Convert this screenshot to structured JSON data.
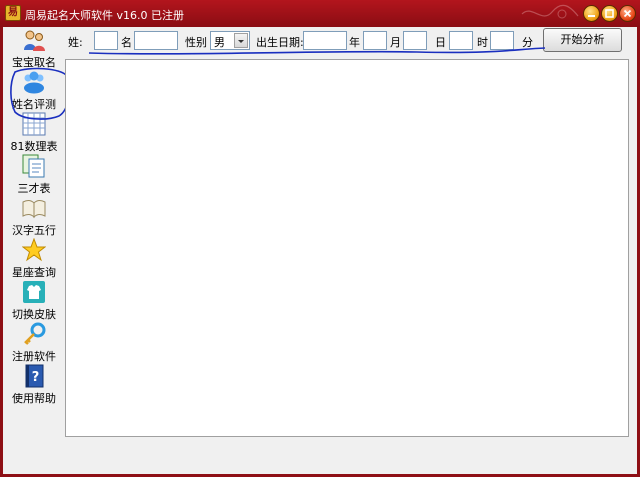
{
  "window": {
    "title": "周易起名大师软件 v16.0  已注册",
    "app_icon_glyph": "易"
  },
  "form": {
    "surname_label": "姓:",
    "name_label": "名",
    "gender_label": "性别",
    "gender_value": "男",
    "birth_label": "出生日期:",
    "year_label": "年",
    "month_label": "月",
    "day_label": "日",
    "hour_label": "时",
    "minute_label": "分",
    "start_label": "开始分析"
  },
  "sidebar": {
    "items": [
      {
        "label": "宝宝取名",
        "icon": "family-icon"
      },
      {
        "label": "姓名评测",
        "icon": "people-group-icon"
      },
      {
        "label": "81数理表",
        "icon": "table-grid-icon"
      },
      {
        "label": "三才表",
        "icon": "documents-icon"
      },
      {
        "label": "汉字五行",
        "icon": "open-book-icon"
      },
      {
        "label": "星座查询",
        "icon": "star-icon"
      },
      {
        "label": "切换皮肤",
        "icon": "shirt-icon"
      },
      {
        "label": "注册软件",
        "icon": "key-icon"
      },
      {
        "label": "使用帮助",
        "icon": "help-book-icon"
      }
    ]
  },
  "colors": {
    "titlebar": "#9e1118",
    "annotation": "#1a2fbf"
  }
}
